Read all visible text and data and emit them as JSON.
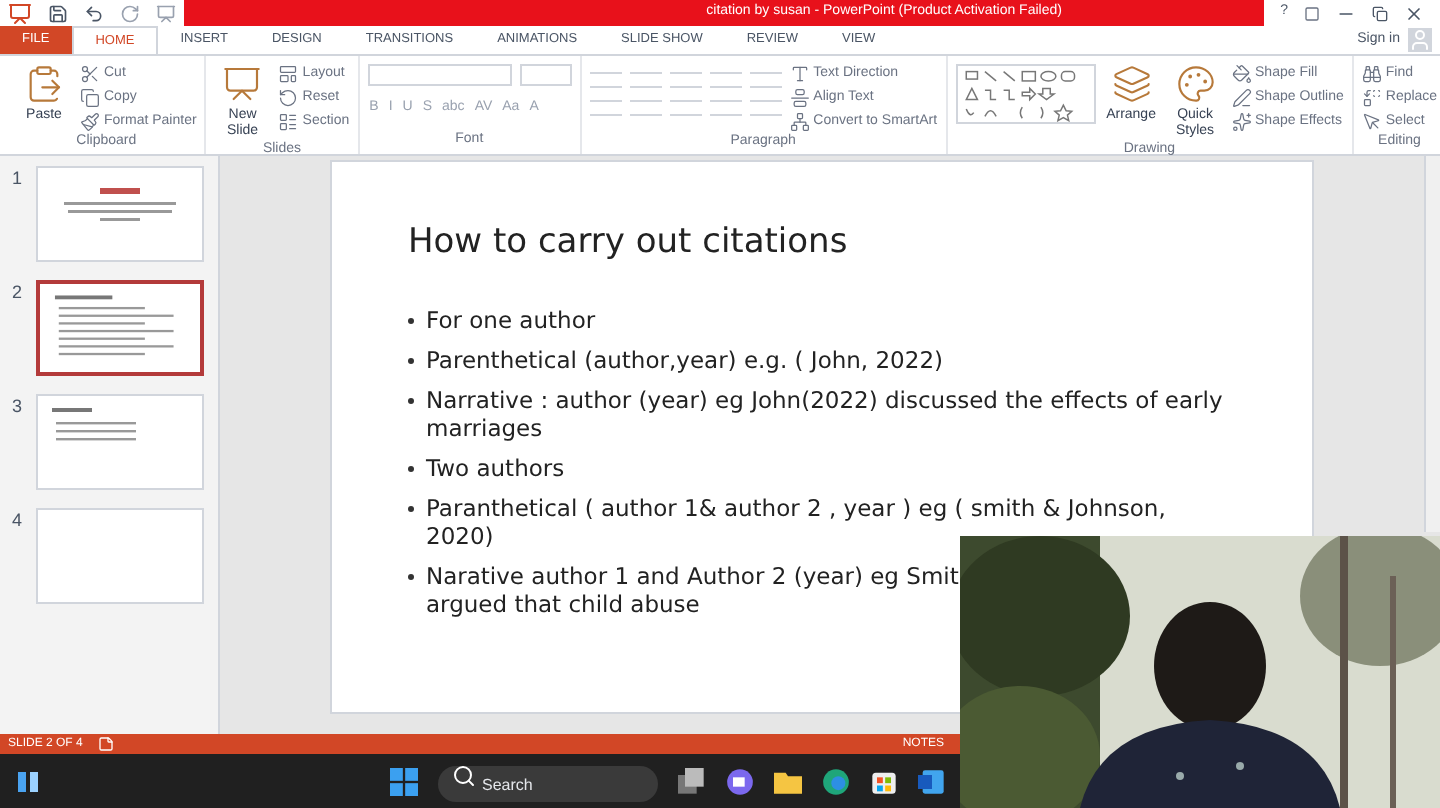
{
  "window": {
    "title": "citation by susan - PowerPoint (Product Activation Failed)",
    "help": "?"
  },
  "tabs": [
    {
      "label": "FILE",
      "kind": "file",
      "selected": false
    },
    {
      "label": "HOME",
      "kind": "tab",
      "selected": true
    },
    {
      "label": "INSERT",
      "kind": "tab",
      "selected": false
    },
    {
      "label": "DESIGN",
      "kind": "tab",
      "selected": false
    },
    {
      "label": "TRANSITIONS",
      "kind": "tab",
      "selected": false
    },
    {
      "label": "ANIMATIONS",
      "kind": "tab",
      "selected": false
    },
    {
      "label": "SLIDE SHOW",
      "kind": "tab",
      "selected": false
    },
    {
      "label": "REVIEW",
      "kind": "tab",
      "selected": false
    },
    {
      "label": "VIEW",
      "kind": "tab",
      "selected": false
    }
  ],
  "account": {
    "label": "Sign in"
  },
  "ribbon": [
    {
      "label": "Clipboard",
      "columns": [
        [
          {
            "kind": "large",
            "label": "Paste"
          }
        ],
        [
          {
            "kind": "small",
            "label": "Cut"
          },
          {
            "kind": "small",
            "label": "Copy"
          },
          {
            "kind": "small",
            "label": "Format Painter"
          }
        ]
      ]
    },
    {
      "label": "Slides",
      "columns": [
        [
          {
            "kind": "large",
            "label": "New Slide"
          }
        ],
        [
          {
            "kind": "small",
            "label": "Layout"
          },
          {
            "kind": "small",
            "label": "Reset"
          },
          {
            "kind": "small",
            "label": "Section"
          }
        ]
      ]
    },
    {
      "label": "Font",
      "columns": [
        [
          {
            "kind": "field"
          },
          {
            "kind": "format",
            "chars": [
              "B",
              "I",
              "U",
              "S",
              "abc",
              "AV",
              "Aa",
              "A"
            ]
          }
        ]
      ]
    },
    {
      "label": "Paragraph",
      "columns": [
        [
          {
            "kind": "bar"
          },
          {
            "kind": "bar"
          }
        ],
        [
          {
            "kind": "small",
            "label": "Text Direction"
          },
          {
            "kind": "small",
            "label": "Align Text"
          },
          {
            "kind": "small",
            "label": "Convert to SmartArt"
          }
        ]
      ]
    },
    {
      "label": "Drawing",
      "columns": [
        [
          {
            "kind": "gallery"
          }
        ],
        [
          {
            "kind": "large",
            "label": "Arrange"
          }
        ],
        [
          {
            "kind": "large",
            "label": "Quick Styles"
          }
        ],
        [
          {
            "kind": "small",
            "label": "Shape Fill"
          },
          {
            "kind": "small",
            "label": "Shape Outline"
          },
          {
            "kind": "small",
            "label": "Shape Effects"
          }
        ]
      ]
    },
    {
      "label": "Editing",
      "columns": [
        [
          {
            "kind": "small",
            "label": "Find"
          },
          {
            "kind": "small",
            "label": "Replace"
          },
          {
            "kind": "small",
            "label": "Select"
          }
        ]
      ]
    }
  ],
  "thumbnails": [
    {
      "number": "1",
      "kind": "title",
      "selected": false
    },
    {
      "number": "2",
      "kind": "bullets",
      "selected": true
    },
    {
      "number": "3",
      "kind": "short",
      "selected": false
    },
    {
      "number": "4",
      "kind": "blank",
      "selected": false
    }
  ],
  "slide": {
    "title": "How to carry out citations",
    "bullets": [
      {
        "lines": [
          "For one author"
        ]
      },
      {
        "lines": [
          "Parenthetical (author,year) e.g. ( John, 2022)"
        ]
      },
      {
        "lines": [
          "Narrative : author (year) eg   John(2022) discussed the effects of early",
          "marriages"
        ]
      },
      {
        "lines": [
          "Two authors"
        ]
      },
      {
        "lines": [
          "Paranthetical  ( author 1& author 2 , year ) eg ( smith & Johnson,",
          "2020)"
        ]
      },
      {
        "lines": [
          "Narative  author 1 and Author 2 (year) eg Smit",
          "argued that child abuse"
        ]
      }
    ]
  },
  "status_bar": {
    "slide_indicator": "SLIDE 2 OF 4",
    "notes": "NOTES"
  },
  "taskbar": {
    "search": {
      "placeholder": "Search"
    }
  }
}
